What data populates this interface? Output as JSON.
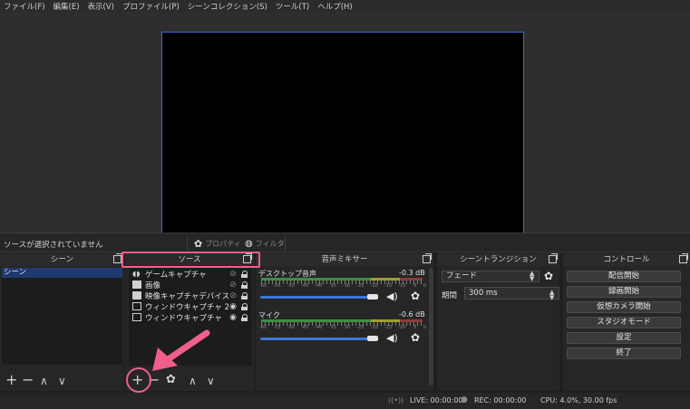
{
  "menu": [
    "ファイル(F)",
    "編集(E)",
    "表示(V)",
    "プロファイル(P)",
    "シーンコレクション(S)",
    "ツール(T)",
    "ヘルプ(H)"
  ],
  "source_bar": {
    "status": "ソースが選択されていません",
    "properties": "プロパティ",
    "filters": "フィルタ"
  },
  "docks": {
    "scenes": "シーン",
    "sources": "ソース",
    "mixer": "音声ミキサー",
    "transitions": "シーントランジション",
    "controls": "コントロール"
  },
  "scenes": [
    "シーン"
  ],
  "sources": [
    {
      "label": "ゲームキャプチャ",
      "icon": "gamepad-icon"
    },
    {
      "label": "画像",
      "icon": "image-icon"
    },
    {
      "label": "映像キャプチャデバイス",
      "icon": "camera-icon"
    },
    {
      "label": "ウィンドウキャプチャ 2",
      "icon": "window-icon"
    },
    {
      "label": "ウィンドウキャプチャ",
      "icon": "window-icon"
    }
  ],
  "mixer": {
    "channels": [
      {
        "name": "デスクトップ音声",
        "db": "-0.3 dB",
        "level": 1.0
      },
      {
        "name": "マイク",
        "db": "-0.6 dB",
        "level": 1.0
      }
    ],
    "scale": [
      "-60",
      "-55",
      "-50",
      "-45",
      "-40",
      "-35",
      "-30",
      "-25",
      "-20",
      "-15",
      "-10",
      "-5",
      "0"
    ]
  },
  "transitions": {
    "selected": "フェード",
    "duration_label": "期間",
    "duration": "300 ms"
  },
  "controls": [
    "配信開始",
    "録画開始",
    "仮想カメラ開始",
    "スタジオモード",
    "設定",
    "終了"
  ],
  "status": {
    "live": "LIVE: 00:00:00",
    "rec": "REC: 00:00:00",
    "cpu": "CPU: 4.0%, 30.00 fps"
  },
  "colors": {
    "accent": "#3b77d8",
    "annotation": "#ee5f8a"
  }
}
